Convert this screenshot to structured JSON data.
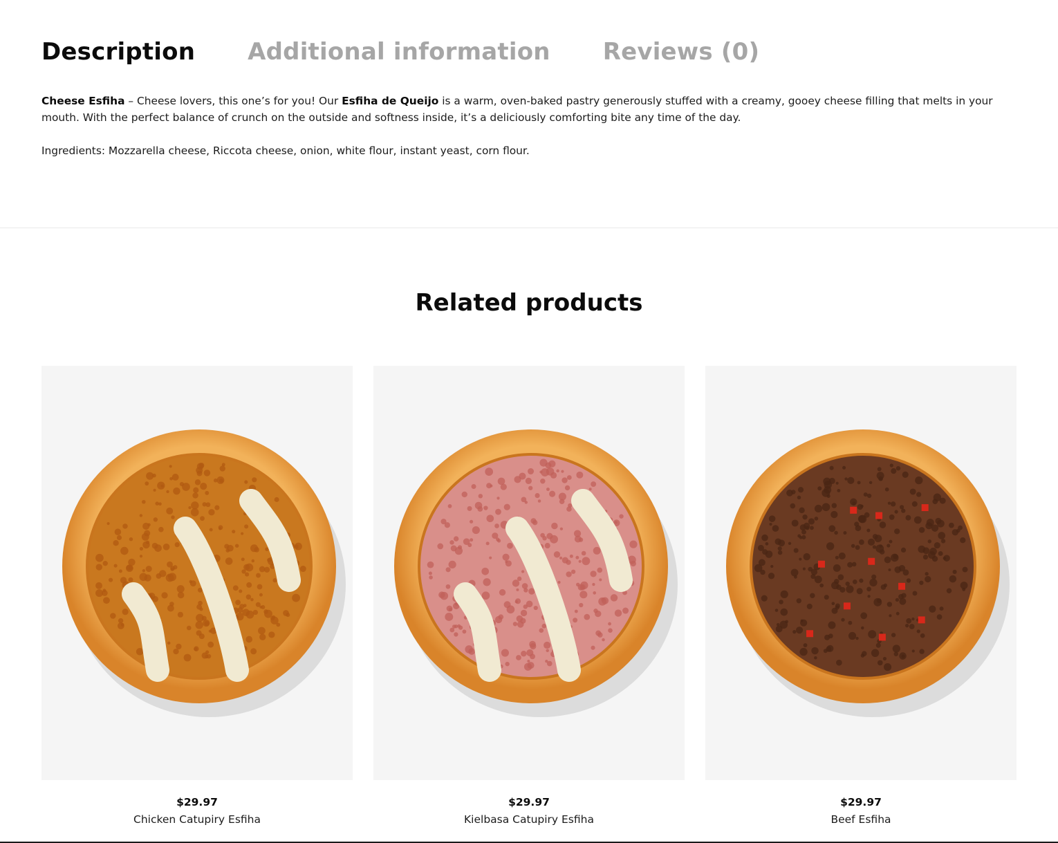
{
  "tabs": [
    {
      "label": "Description"
    },
    {
      "label": "Additional information"
    },
    {
      "label": "Reviews (0)"
    }
  ],
  "description": {
    "p1_bold_name": "Cheese Esfiha",
    "p1_text_a": " – Cheese lovers, this one’s for you! Our ",
    "p1_bold_product": "Esfiha de Queijo",
    "p1_text_b": " is a warm, oven-baked pastry generously stuffed with a creamy, gooey cheese filling that melts in your mouth. With the perfect balance of crunch on the outside and softness inside, it’s a deliciously comforting bite any time of the day.",
    "ingredients": "Ingredients: Mozzarella cheese, Riccota cheese, onion, white flour, instant yeast, corn flour."
  },
  "related": {
    "title": "Related products",
    "products": [
      {
        "price": "$29.97",
        "name": "Chicken Catupiry Esfiha",
        "image_icon": "chicken-catupiry-esfiha-image",
        "filling_color": "#c9781f",
        "crumb_color": "#b05a12",
        "topping": true
      },
      {
        "price": "$29.97",
        "name": "Kielbasa Catupiry Esfiha",
        "image_icon": "kielbasa-catupiry-esfiha-image",
        "filling_color": "#d98f8a",
        "crumb_color": "#c0605a",
        "topping": true
      },
      {
        "price": "$29.97",
        "name": "Beef Esfiha",
        "image_icon": "beef-esfiha-image",
        "filling_color": "#6a3a22",
        "crumb_color": "#4a2514",
        "topping": false
      }
    ]
  },
  "colors": {
    "crust_outer": "#d9842a",
    "crust_inner": "#f2b25a",
    "cheese": "#f1ead2",
    "card_bg": "#f5f5f5"
  }
}
